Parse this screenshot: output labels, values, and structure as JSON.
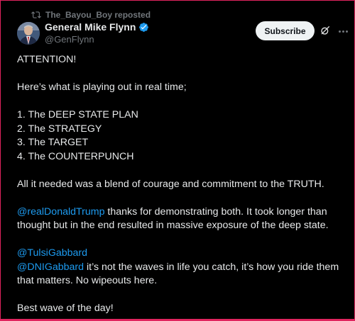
{
  "repost": {
    "text": "The_Bayou_Boy reposted",
    "icon": "repost-icon"
  },
  "author": {
    "display_name": "General Mike Flynn",
    "handle": "@GenFlynn",
    "verified_icon": "verified-badge-icon",
    "verified_color": "#1d9bf0"
  },
  "actions": {
    "subscribe_label": "Subscribe",
    "grok_icon": "grok-icon",
    "more_icon": "more-icon"
  },
  "post": {
    "attention": "ATTENTION!",
    "intro": "Here’s what is playing out in real time;",
    "list": [
      "1. The DEEP STATE PLAN",
      "2. The STRATEGY",
      "3. The TARGET",
      "4. The COUNTERPUNCH"
    ],
    "blend": "All it needed was a blend of courage and commitment to the TRUTH.",
    "mention_trump": "@realDonaldTrump",
    "trump_text": " thanks for demonstrating both. It took longer than thought but in the end resulted in massive exposure of the deep state.",
    "mention_tulsi": "@TulsiGabbard",
    "mention_dni": "@DNIGabbard",
    "dni_text": " it’s not the waves in life you catch, it’s how you ride them that matters. No wipeouts here.",
    "closing": "Best wave of the day!"
  },
  "colors": {
    "background": "#000000",
    "text": "#e7e9ea",
    "muted": "#71767b",
    "link": "#1d9bf0",
    "frame": "#e0245e"
  }
}
